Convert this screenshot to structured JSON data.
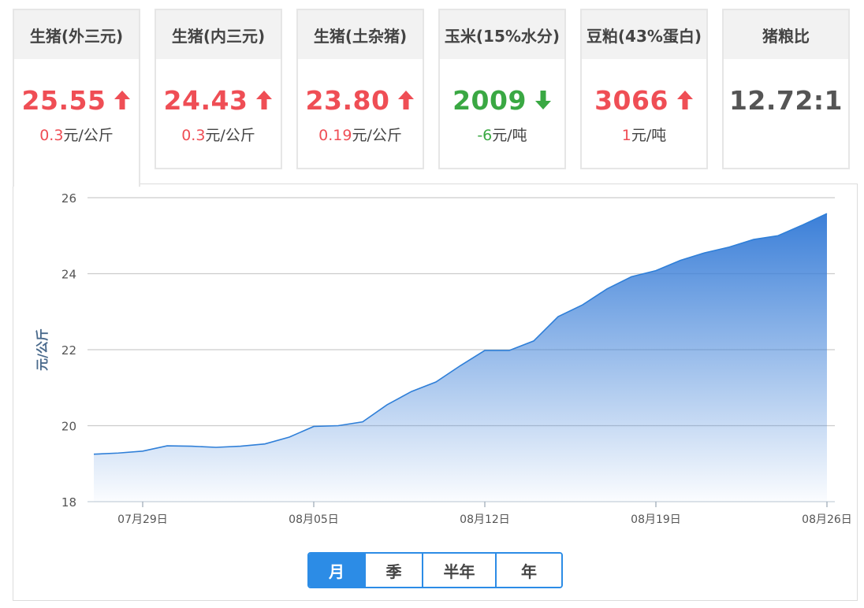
{
  "cards": [
    {
      "title": "生猪(外三元)",
      "price": "25.55",
      "direction": "up",
      "change": "0.3",
      "unit": "元/公斤"
    },
    {
      "title": "生猪(内三元)",
      "price": "24.43",
      "direction": "up",
      "change": "0.3",
      "unit": "元/公斤"
    },
    {
      "title": "生猪(土杂猪)",
      "price": "23.80",
      "direction": "up",
      "change": "0.19",
      "unit": "元/公斤"
    },
    {
      "title": "玉米(15%水分)",
      "price": "2009",
      "direction": "down",
      "change": "-6",
      "unit": "元/吨"
    },
    {
      "title": "豆粕(43%蛋白)",
      "price": "3066",
      "direction": "up",
      "change": "1",
      "unit": "元/吨"
    },
    {
      "title": "猪粮比",
      "price": "12.72:1",
      "direction": "none",
      "change": "",
      "unit": ""
    }
  ],
  "colors": {
    "up": "#ef4e55",
    "down": "#3aa843",
    "accent": "#2c8ce6",
    "area": "#3b7fd8"
  },
  "range_tabs": [
    "月",
    "季",
    "半年",
    "年"
  ],
  "selected_tab": "月",
  "chart_data": {
    "type": "area",
    "ylabel": "元/公斤",
    "ylim": [
      18,
      26
    ],
    "yticks": [
      18,
      20,
      22,
      24,
      26
    ],
    "x_tick_labels": [
      "07月29日",
      "08月05日",
      "08月12日",
      "08月19日",
      "08月26日"
    ],
    "x_ticks_day_index": [
      2,
      9,
      16,
      23,
      30
    ],
    "x": [
      "07月27日",
      "07月28日",
      "07月29日",
      "07月30日",
      "07月31日",
      "08月01日",
      "08月02日",
      "08月03日",
      "08月04日",
      "08月05日",
      "08月06日",
      "08月07日",
      "08月08日",
      "08月09日",
      "08月10日",
      "08月11日",
      "08月12日",
      "08月13日",
      "08月14日",
      "08月15日",
      "08月16日",
      "08月17日",
      "08月18日",
      "08月19日",
      "08月20日",
      "08月21日",
      "08月22日",
      "08月23日",
      "08月24日",
      "08月25日",
      "08月26日"
    ],
    "values": [
      19.25,
      19.28,
      19.33,
      19.47,
      19.46,
      19.43,
      19.46,
      19.52,
      19.7,
      19.98,
      20.0,
      20.1,
      20.55,
      20.9,
      21.15,
      21.58,
      21.98,
      21.98,
      22.23,
      22.87,
      23.18,
      23.6,
      23.92,
      24.08,
      24.35,
      24.55,
      24.7,
      24.9,
      25.0,
      25.28,
      25.58
    ],
    "grid": true
  }
}
